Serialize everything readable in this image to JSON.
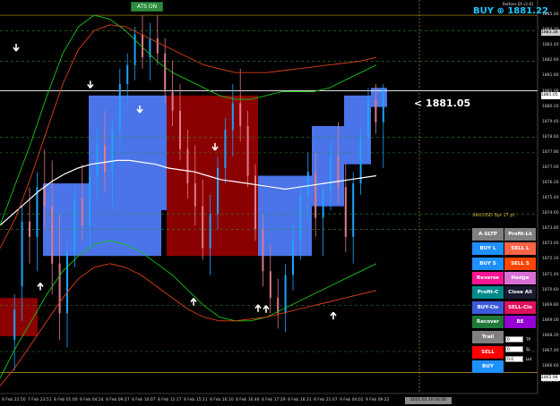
{
  "chart_data": {
    "type": "candlestick",
    "symbol": "XAUUSD",
    "ylim": [
      1865.2,
      1885.8
    ],
    "y_ticks": [
      "1885.80",
      "1885.00",
      "1884.20",
      "1883.40",
      "1882.60",
      "1881.80",
      "1881.00",
      "1880.20",
      "1879.40",
      "1878.60",
      "1877.80",
      "1877.00",
      "1876.20",
      "1875.40",
      "1874.60",
      "1873.80",
      "1873.00",
      "1872.20",
      "1871.40",
      "1870.60",
      "1869.80",
      "1869.00",
      "1868.20",
      "1867.40",
      "1866.60",
      "1865.80"
    ],
    "x_ticks": [
      "8 Feb 22:50",
      "7 Feb 23:51",
      "8 Feb 01:00",
      "8 Feb 04:24",
      "8 Feb 09:27",
      "8 Feb 10:07",
      "8 Feb 12:17",
      "8 Feb 15:11",
      "8 Feb 16:10",
      "8 Feb 16:46",
      "8 Feb 17:29",
      "8 Feb 18:31",
      "8 Feb 21:07",
      "9 Feb 04:02",
      "9 Feb 09:22"
    ],
    "current_price_tag": "1881.05",
    "top_price_tag": "1883.38",
    "low_price_tag": "1865.98",
    "date_tag": "2021.02.10 04:30",
    "candles": [
      {
        "o": 1868.0,
        "h": 1870.4,
        "l": 1866.4,
        "c": 1869.6
      },
      {
        "o": 1870.8,
        "h": 1875.0,
        "l": 1869.0,
        "c": 1874.2
      },
      {
        "o": 1874.2,
        "h": 1876.0,
        "l": 1872.0,
        "c": 1873.4
      },
      {
        "o": 1873.4,
        "h": 1876.8,
        "l": 1871.6,
        "c": 1876.0
      },
      {
        "o": 1876.0,
        "h": 1878.0,
        "l": 1873.8,
        "c": 1875.0
      },
      {
        "o": 1875.0,
        "h": 1877.4,
        "l": 1870.4,
        "c": 1872.0
      },
      {
        "o": 1872.0,
        "h": 1874.6,
        "l": 1868.0,
        "c": 1869.4
      },
      {
        "o": 1869.4,
        "h": 1873.2,
        "l": 1867.6,
        "c": 1872.6
      },
      {
        "o": 1872.6,
        "h": 1876.0,
        "l": 1871.8,
        "c": 1875.4
      },
      {
        "o": 1875.4,
        "h": 1877.2,
        "l": 1873.2,
        "c": 1874.0
      },
      {
        "o": 1874.0,
        "h": 1877.0,
        "l": 1872.8,
        "c": 1876.6
      },
      {
        "o": 1876.6,
        "h": 1879.0,
        "l": 1875.4,
        "c": 1878.2
      },
      {
        "o": 1878.2,
        "h": 1880.0,
        "l": 1875.8,
        "c": 1876.8
      },
      {
        "o": 1876.8,
        "h": 1879.6,
        "l": 1875.0,
        "c": 1879.0
      },
      {
        "o": 1879.0,
        "h": 1882.2,
        "l": 1877.8,
        "c": 1881.4
      },
      {
        "o": 1881.4,
        "h": 1883.0,
        "l": 1880.2,
        "c": 1882.4
      },
      {
        "o": 1882.4,
        "h": 1884.4,
        "l": 1881.6,
        "c": 1884.0
      },
      {
        "o": 1884.0,
        "h": 1885.0,
        "l": 1882.2,
        "c": 1882.8
      },
      {
        "o": 1882.8,
        "h": 1884.6,
        "l": 1881.6,
        "c": 1883.8
      },
      {
        "o": 1883.8,
        "h": 1885.0,
        "l": 1882.4,
        "c": 1883.0
      },
      {
        "o": 1883.0,
        "h": 1883.8,
        "l": 1880.4,
        "c": 1881.0
      },
      {
        "o": 1881.0,
        "h": 1882.6,
        "l": 1879.2,
        "c": 1880.0
      },
      {
        "o": 1880.0,
        "h": 1881.4,
        "l": 1877.4,
        "c": 1878.0
      },
      {
        "o": 1878.0,
        "h": 1879.0,
        "l": 1875.4,
        "c": 1876.2
      },
      {
        "o": 1876.2,
        "h": 1878.2,
        "l": 1874.0,
        "c": 1875.0
      },
      {
        "o": 1875.0,
        "h": 1876.4,
        "l": 1872.2,
        "c": 1872.8
      },
      {
        "o": 1872.8,
        "h": 1875.6,
        "l": 1871.4,
        "c": 1874.6
      },
      {
        "o": 1874.6,
        "h": 1877.6,
        "l": 1873.8,
        "c": 1877.0
      },
      {
        "o": 1877.0,
        "h": 1879.6,
        "l": 1876.2,
        "c": 1879.0
      },
      {
        "o": 1879.0,
        "h": 1881.4,
        "l": 1877.6,
        "c": 1880.4
      },
      {
        "o": 1880.4,
        "h": 1882.2,
        "l": 1878.4,
        "c": 1879.2
      },
      {
        "o": 1879.2,
        "h": 1880.0,
        "l": 1876.0,
        "c": 1876.6
      },
      {
        "o": 1876.6,
        "h": 1877.2,
        "l": 1873.2,
        "c": 1873.8
      },
      {
        "o": 1873.8,
        "h": 1874.6,
        "l": 1870.8,
        "c": 1871.6
      },
      {
        "o": 1871.6,
        "h": 1873.0,
        "l": 1869.4,
        "c": 1870.2
      },
      {
        "o": 1870.2,
        "h": 1871.2,
        "l": 1868.6,
        "c": 1869.4
      },
      {
        "o": 1869.4,
        "h": 1872.0,
        "l": 1868.4,
        "c": 1871.4
      },
      {
        "o": 1871.4,
        "h": 1874.0,
        "l": 1870.6,
        "c": 1873.2
      },
      {
        "o": 1873.2,
        "h": 1876.0,
        "l": 1872.2,
        "c": 1875.6
      },
      {
        "o": 1875.6,
        "h": 1877.8,
        "l": 1874.2,
        "c": 1876.8
      },
      {
        "o": 1876.8,
        "h": 1877.8,
        "l": 1873.4,
        "c": 1874.4
      },
      {
        "o": 1874.4,
        "h": 1876.2,
        "l": 1872.4,
        "c": 1875.8
      },
      {
        "o": 1875.8,
        "h": 1878.4,
        "l": 1874.8,
        "c": 1877.6
      },
      {
        "o": 1877.6,
        "h": 1879.4,
        "l": 1875.2,
        "c": 1876.0
      },
      {
        "o": 1876.0,
        "h": 1877.2,
        "l": 1872.6,
        "c": 1873.4
      },
      {
        "o": 1873.4,
        "h": 1876.8,
        "l": 1872.0,
        "c": 1876.2
      },
      {
        "o": 1876.2,
        "h": 1879.0,
        "l": 1875.6,
        "c": 1878.6
      },
      {
        "o": 1878.6,
        "h": 1881.2,
        "l": 1877.4,
        "c": 1880.6
      },
      {
        "o": 1880.6,
        "h": 1881.4,
        "l": 1878.8,
        "c": 1879.4
      },
      {
        "o": 1879.4,
        "h": 1881.4,
        "l": 1877.0,
        "c": 1881.05
      }
    ],
    "series": [
      {
        "name": "",
        "color": "#ffffff",
        "values": [
          1874.0,
          1874.6,
          1875.2,
          1875.8,
          1876.3,
          1876.7,
          1877.0,
          1877.2,
          1877.3,
          1877.4,
          1877.4,
          1877.3,
          1877.2,
          1877.0,
          1876.9,
          1876.8,
          1876.6,
          1876.4,
          1876.3,
          1876.2,
          1876.1,
          1876.0,
          1875.9,
          1876.0,
          1876.1,
          1876.2,
          1876.3,
          1876.4,
          1876.5,
          1876.6
        ]
      },
      {
        "name": "",
        "color": "#18c418",
        "values": [
          1874.0,
          1876.2,
          1878.4,
          1880.8,
          1883.0,
          1884.4,
          1885.0,
          1884.8,
          1884.2,
          1883.4,
          1882.6,
          1882.0,
          1881.6,
          1881.2,
          1880.8,
          1880.6,
          1880.6,
          1880.8,
          1881.0,
          1881.0,
          1881.0,
          1881.2,
          1881.6,
          1882.0,
          1882.4
        ]
      },
      {
        "name": "",
        "color": "#e0401a",
        "values": [
          1872.8,
          1874.4,
          1876.6,
          1879.0,
          1881.4,
          1883.2,
          1884.2,
          1884.5,
          1884.4,
          1884.0,
          1883.6,
          1883.2,
          1882.8,
          1882.4,
          1882.2,
          1882.0,
          1882.0,
          1882.0,
          1882.1,
          1882.2,
          1882.3,
          1882.4,
          1882.5,
          1882.6,
          1882.8
        ]
      },
      {
        "name": "",
        "color": "#18c418",
        "values": [
          1866.0,
          1867.6,
          1869.0,
          1870.4,
          1871.6,
          1872.4,
          1873.0,
          1873.2,
          1873.0,
          1872.6,
          1872.0,
          1871.4,
          1870.6,
          1869.8,
          1869.2,
          1869.0,
          1869.0,
          1869.2,
          1869.6,
          1870.0,
          1870.4,
          1870.8,
          1871.2,
          1871.6,
          1872.0
        ]
      },
      {
        "name": "",
        "color": "#e0401a",
        "values": [
          1865.6,
          1866.6,
          1867.8,
          1869.0,
          1870.2,
          1871.2,
          1871.8,
          1872.0,
          1871.8,
          1871.4,
          1870.8,
          1870.2,
          1869.6,
          1869.2,
          1869.0,
          1869.0,
          1869.1,
          1869.2,
          1869.4,
          1869.6,
          1869.8,
          1870.0,
          1870.2,
          1870.4,
          1870.6
        ]
      }
    ],
    "buy_zones": [
      {
        "from": 1872.4,
        "to": 1876.2,
        "x0": 0.08,
        "x1": 0.3
      },
      {
        "from": 1874.8,
        "to": 1880.8,
        "x0": 0.165,
        "x1": 0.31
      },
      {
        "from": 1872.4,
        "to": 1876.6,
        "x0": 0.48,
        "x1": 0.58
      },
      {
        "from": 1875.0,
        "to": 1879.2,
        "x0": 0.58,
        "x1": 0.64
      },
      {
        "from": 1877.2,
        "to": 1880.8,
        "x0": 0.64,
        "x1": 0.69
      },
      {
        "from": 1880.2,
        "to": 1881.2,
        "x0": 0.69,
        "x1": 0.72
      }
    ],
    "sell_zones": [
      {
        "from": 1868.2,
        "to": 1870.2,
        "x0": 0.0,
        "x1": 0.07
      },
      {
        "from": 1872.4,
        "to": 1880.8,
        "x0": 0.31,
        "x1": 0.48
      }
    ],
    "arrows_up": [
      0.075,
      0.48,
      0.495,
      0.62,
      0.36
    ],
    "arrows_down": [
      0.03,
      0.168,
      0.26,
      0.4
    ],
    "hlines_dashed": [
      1884.2,
      1882.6,
      1878.6,
      1877.8,
      1874.6,
      1873.8,
      1869.8,
      1867.4
    ],
    "hline_solid_white": 1881.05,
    "hline_gold_top": 1885.0,
    "hline_gold_bottom": 1866.3,
    "vline_gold_x": 0.78
  },
  "header": {
    "ea_label": "Buttons EA  v1.61",
    "auto_label": "ATS ON",
    "buy_status": "BUY ⊕ 1881.22",
    "price_callout": "<  1881.05",
    "spread_label": "XAU/USD Spr 17 pt"
  },
  "panel": {
    "buttons": [
      {
        "key": "a_sltp",
        "label": "A-SLTP",
        "bg": "#808080",
        "color": "#ffffff"
      },
      {
        "key": "profit_lk",
        "label": "Profit-Lk",
        "bg": "#808080",
        "color": "#ffffff"
      },
      {
        "key": "buy_l",
        "label": "BUY L",
        "bg": "#1e90ff",
        "color": "#ffffff"
      },
      {
        "key": "sell_l",
        "label": "SELL L",
        "bg": "#ff6347",
        "color": "#ffffff"
      },
      {
        "key": "buy_s",
        "label": "BUY S",
        "bg": "#1e90ff",
        "color": "#ffffff"
      },
      {
        "key": "sell_s",
        "label": "SELL S",
        "bg": "#ff4500",
        "color": "#ffffff"
      },
      {
        "key": "reverse",
        "label": "Reverse",
        "bg": "#ff1493",
        "color": "#ffffff"
      },
      {
        "key": "hedge",
        "label": "Hedge",
        "bg": "#da70d6",
        "color": "#ffffff"
      },
      {
        "key": "profit_c",
        "label": "Profit-C",
        "bg": "#008b8b",
        "color": "#ffffff"
      },
      {
        "key": "close_all",
        "label": "Close All",
        "bg": "#1a1a2e",
        "color": "#ffffff"
      },
      {
        "key": "buy_clo",
        "label": "BUY-Clo",
        "bg": "#3b5bdb",
        "color": "#ffffff"
      },
      {
        "key": "sell_clo",
        "label": "SELL-Clo",
        "bg": "#e0115f",
        "color": "#ffffff"
      },
      {
        "key": "recover",
        "label": "Recover",
        "bg": "#1f7a3a",
        "color": "#ffffff"
      },
      {
        "key": "be",
        "label": "BE",
        "bg": "#9400d3",
        "color": "#ffffff"
      },
      {
        "key": "trail",
        "label": "Trail",
        "bg": "#808080",
        "color": "#ffffff"
      },
      {
        "key": "sell",
        "label": "SELL",
        "bg": "#ff0000",
        "color": "#ffffff"
      },
      {
        "key": "buy",
        "label": "BUY",
        "bg": "#1e90ff",
        "color": "#ffffff"
      }
    ],
    "inputs": [
      {
        "key": "tp",
        "value": "0",
        "label": "TP"
      },
      {
        "key": "sl",
        "value": "0",
        "label": "SL"
      },
      {
        "key": "lot",
        "value": "0.0",
        "label": "Lot"
      }
    ]
  }
}
